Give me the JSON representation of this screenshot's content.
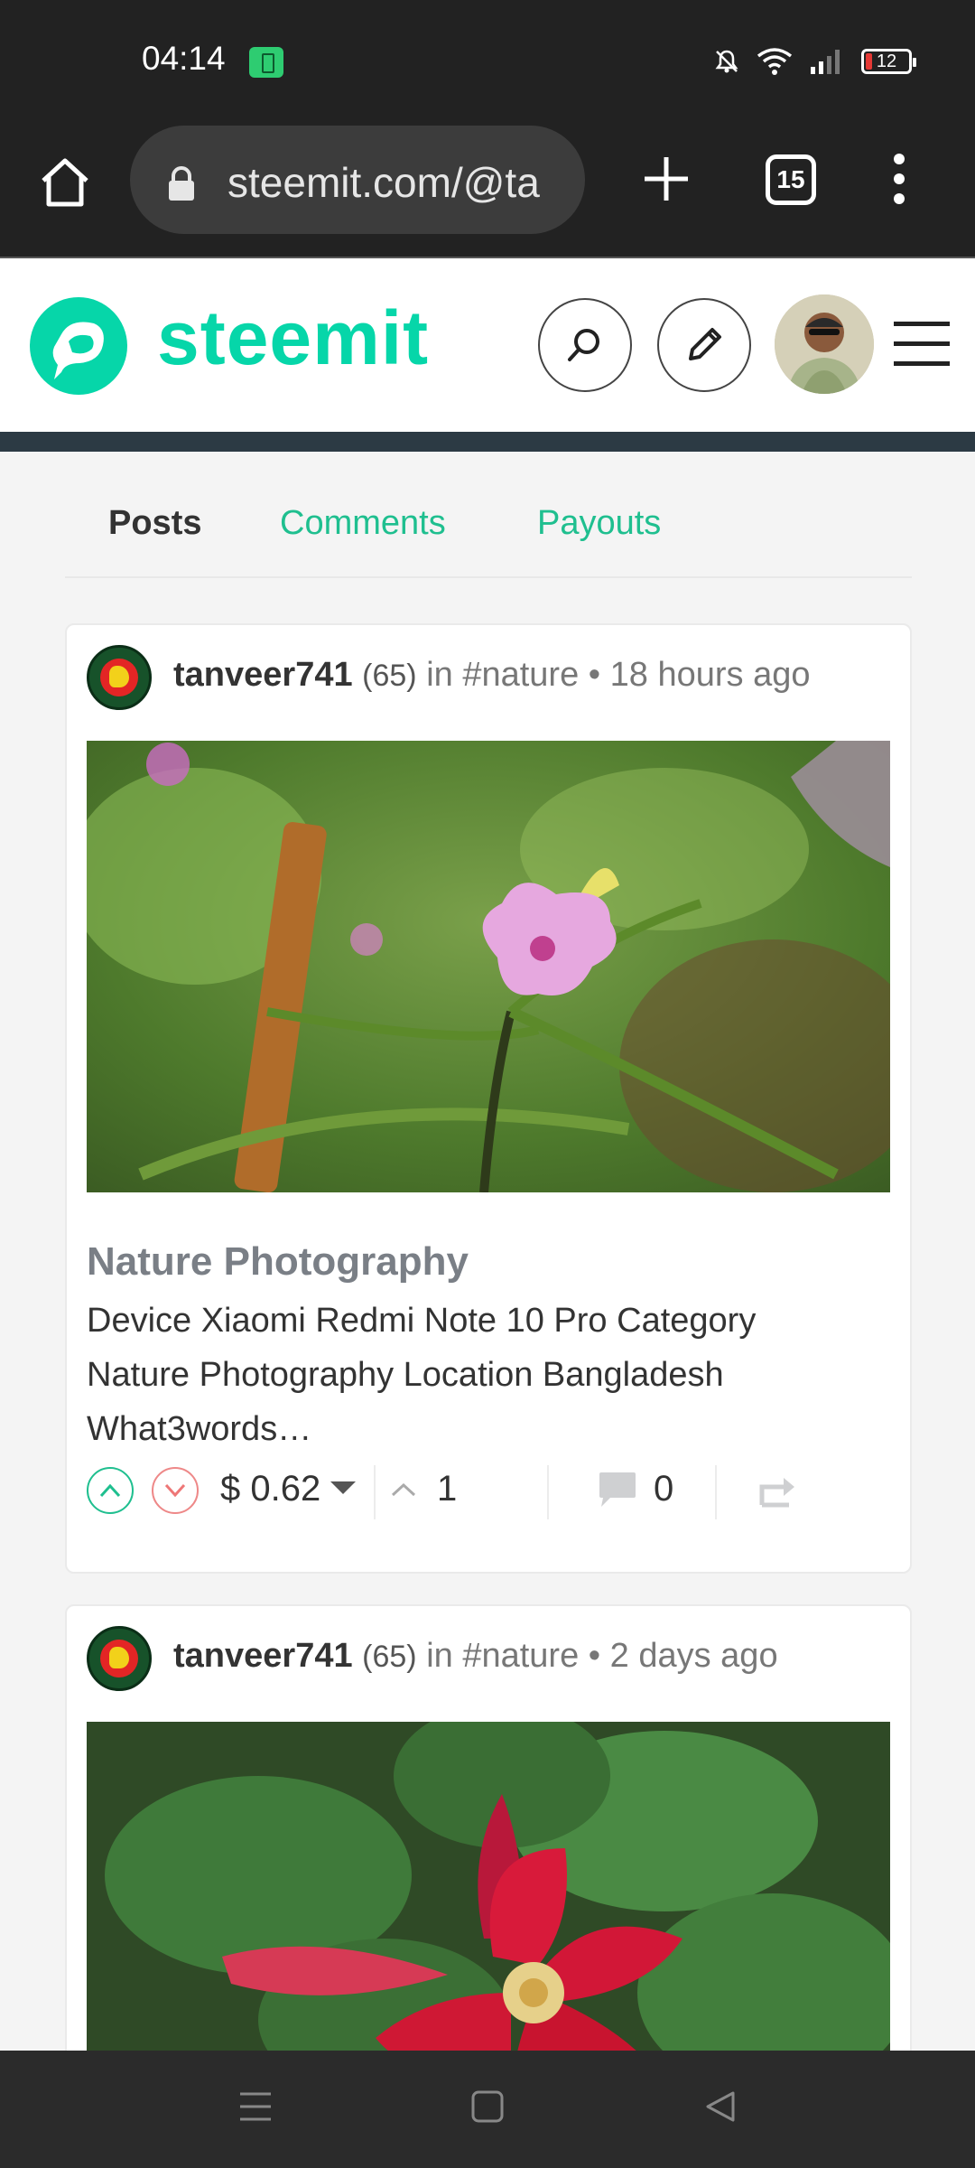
{
  "status": {
    "time": "04:14",
    "battery": "12"
  },
  "browser": {
    "url": "steemit.com/@ta",
    "tab_count": "15"
  },
  "site": {
    "logo_text": "steemit",
    "brand_color": "#06d6a9"
  },
  "tabs": [
    {
      "label": "Posts",
      "active": true
    },
    {
      "label": "Comments",
      "active": false
    },
    {
      "label": "Payouts",
      "active": false
    }
  ],
  "posts": [
    {
      "author": "tanveer741",
      "reputation": "(65)",
      "in_text": "in",
      "category": "#nature",
      "dot": "•",
      "time": "18 hours ago",
      "title": "Nature Photography",
      "excerpt": "Device Xiaomi Redmi Note 10 Pro Category Nature Photography Location Bangladesh What3words…",
      "payout": "$ 0.62",
      "votes": "1",
      "comments": "0"
    },
    {
      "author": "tanveer741",
      "reputation": "(65)",
      "in_text": "in",
      "category": "#nature",
      "dot": "•",
      "time": "2 days ago"
    }
  ],
  "icons": {
    "home": "home-icon",
    "lock": "lock-icon",
    "plus": "plus-icon",
    "menu": "menu-dots-icon",
    "search": "search-icon",
    "edit": "pencil-icon",
    "hamburger": "hamburger-icon",
    "upvote": "upvote-icon",
    "downvote": "downvote-icon",
    "comment": "comment-icon",
    "reblog": "reblog-icon"
  }
}
